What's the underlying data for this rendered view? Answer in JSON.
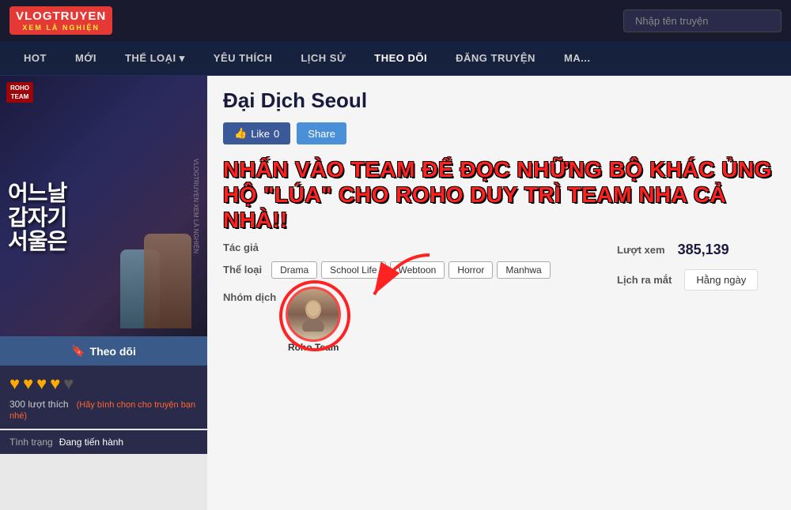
{
  "site": {
    "logo_main": "VLOGTRUYEN",
    "logo_sub": "XEM LÀ NGHIỆN",
    "search_placeholder": "Nhập tên truyện"
  },
  "nav": {
    "items": [
      {
        "label": "HOT",
        "active": false
      },
      {
        "label": "MỚI",
        "active": false
      },
      {
        "label": "THỂ LOẠI ▾",
        "active": false
      },
      {
        "label": "YÊU THÍCH",
        "active": false
      },
      {
        "label": "LỊCH SỬ",
        "active": false
      },
      {
        "label": "THEO DÕI",
        "active": true
      },
      {
        "label": "ĐĂNG TRUYỆN",
        "active": false
      },
      {
        "label": "MA...",
        "active": false
      }
    ]
  },
  "manga": {
    "title": "Đại Dịch Seoul",
    "follow_label": "Theo dõi",
    "like_label": "Like",
    "like_count": "0",
    "share_label": "Share",
    "promo_text": "NHẤN VÀO TEAM ĐỂ ĐỌC NHỮNG BỘ KHÁC ỦNG HỘ \"LÚA\" CHO ROHO DUY TRÌ TEAM NHA CẢ NHÀ!!",
    "author_label": "Tác giả",
    "author_value": "",
    "genre_label": "Thể loại",
    "genres": [
      "Drama",
      "School Life",
      "Webtoon",
      "Horror",
      "Manhwa"
    ],
    "group_label": "Nhóm dịch",
    "translator_name": "Roho Team",
    "views_label": "Lượt xem",
    "views_count": "385,139",
    "release_label": "Lịch ra mắt",
    "release_value": "Hằng ngày",
    "rating_count": "300 lượt thích",
    "rating_prompt": "(Hãy bình chọn cho truyện bạn nhé)",
    "hearts_filled": 4,
    "hearts_total": 5,
    "status_label": "Tình trạng",
    "status_value": "Đang tiến hành",
    "cover_title_kr": "어느날\n갑자기\n서울은",
    "watermark": "VLOGTRUYEN\nXEM LÀ NGHIỆN"
  }
}
